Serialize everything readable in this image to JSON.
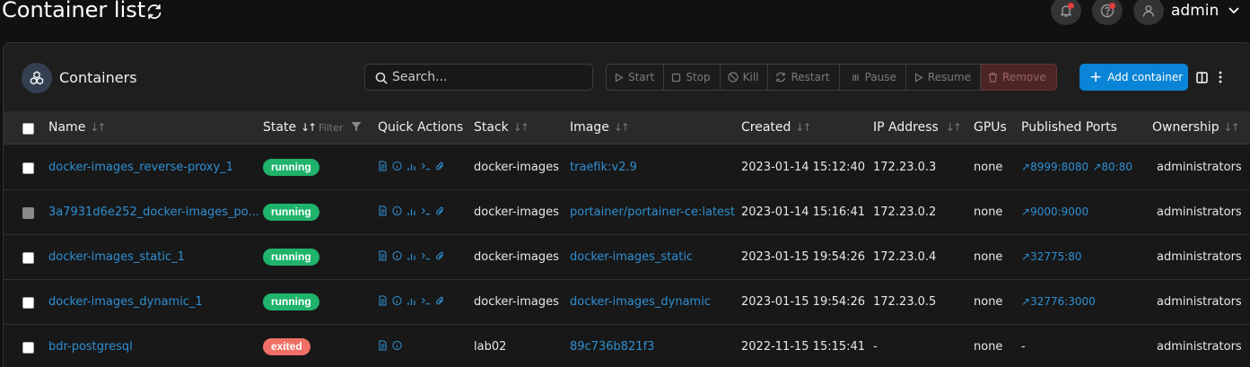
{
  "page": {
    "title": "Container list",
    "user": "admin"
  },
  "widget": {
    "title": "Containers",
    "search_placeholder": "Search...",
    "actions": {
      "start": "Start",
      "stop": "Stop",
      "kill": "Kill",
      "restart": "Restart",
      "pause": "Pause",
      "resume": "Resume",
      "remove": "Remove"
    },
    "add_label": "Add container"
  },
  "columns": {
    "name": "Name",
    "state": "State",
    "state_filter": "Filter",
    "quick_actions": "Quick Actions",
    "stack": "Stack",
    "image": "Image",
    "created": "Created",
    "ip": "IP Address",
    "gpus": "GPUs",
    "ports": "Published Ports",
    "ownership": "Ownership"
  },
  "colors": {
    "running": "#1fb36b",
    "exited": "#f07066",
    "accent": "#0a84d6"
  },
  "rows": [
    {
      "name": "docker-images_reverse-proxy_1",
      "state": "running",
      "stack": "docker-images",
      "image": "traefik:v2.9",
      "created": "2023-01-14 15:12:40",
      "ip": "172.23.0.3",
      "gpus": "none",
      "ports": [
        "8999:8080",
        "80:80"
      ],
      "ownership": "administrators"
    },
    {
      "name": "3a7931d6e252_docker-images_po...",
      "state": "running",
      "stack": "docker-images",
      "image": "portainer/portainer-ce:latest",
      "created": "2023-01-14 15:16:41",
      "ip": "172.23.0.2",
      "gpus": "none",
      "ports": [
        "9000:9000"
      ],
      "ownership": "administrators"
    },
    {
      "name": "docker-images_static_1",
      "state": "running",
      "stack": "docker-images",
      "image": "docker-images_static",
      "created": "2023-01-15 19:54:26",
      "ip": "172.23.0.4",
      "gpus": "none",
      "ports": [
        "32775:80"
      ],
      "ownership": "administrators"
    },
    {
      "name": "docker-images_dynamic_1",
      "state": "running",
      "stack": "docker-images",
      "image": "docker-images_dynamic",
      "created": "2023-01-15 19:54:26",
      "ip": "172.23.0.5",
      "gpus": "none",
      "ports": [
        "32776:3000"
      ],
      "ownership": "administrators"
    },
    {
      "name": "bdr-postgresql",
      "state": "exited",
      "stack": "lab02",
      "image": "89c736b821f3",
      "created": "2022-11-15 15:15:41",
      "ip": "-",
      "gpus": "none",
      "ports_text": "-",
      "ownership": "administrators"
    }
  ]
}
